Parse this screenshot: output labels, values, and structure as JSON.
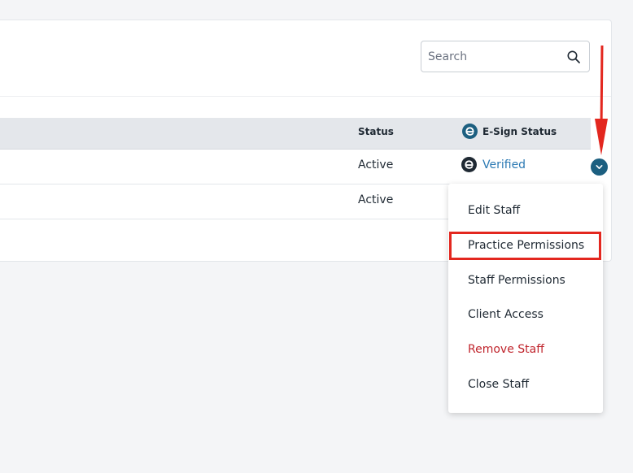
{
  "search": {
    "placeholder": "Search",
    "icon": "magnifier-icon"
  },
  "table": {
    "headers": {
      "status": "Status",
      "esign_status": "E-Sign Status"
    },
    "rows": [
      {
        "status": "Active",
        "esign": "Verified"
      },
      {
        "status": "Active",
        "esign": ""
      }
    ]
  },
  "menu": {
    "items": [
      {
        "label": "Edit Staff"
      },
      {
        "label": "Practice Permissions"
      },
      {
        "label": "Staff Permissions"
      },
      {
        "label": "Client Access"
      },
      {
        "label": "Remove Staff"
      },
      {
        "label": "Close Staff"
      }
    ]
  },
  "colors": {
    "accent": "#1c5f80",
    "link": "#2b79b3",
    "danger": "#c0242c",
    "annotation": "#e3271f"
  }
}
